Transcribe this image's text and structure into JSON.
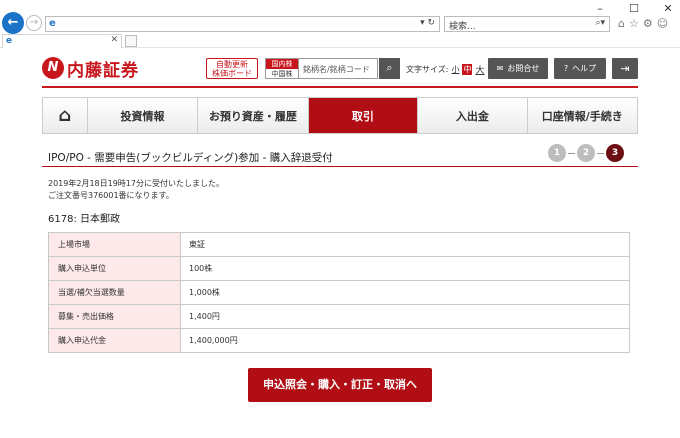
{
  "browser": {
    "window_controls": [
      "–",
      "☐",
      "✕"
    ],
    "search_placeholder": "検索...",
    "addr_tools": "▾  ↻"
  },
  "header": {
    "logo_text": "内藤証券",
    "auto_board_line1": "自動更新",
    "auto_board_line2": "株価ボード",
    "market_top": "国内株",
    "market_bottom": "中国株",
    "stock_search_placeholder": "銘柄名/銘柄コード",
    "font_size_label": "文字サイズ:",
    "font_small": "小",
    "font_medium": "中",
    "font_large": "大",
    "contact_label": "お問合せ",
    "help_label": "ヘルプ"
  },
  "nav": {
    "items": [
      {
        "label": "投資情報"
      },
      {
        "label": "お預り資産・履歴"
      },
      {
        "label": "取引"
      },
      {
        "label": "入出金"
      },
      {
        "label": "口座情報/手続き"
      }
    ],
    "active_index": 2
  },
  "page": {
    "title": "IPO/PO - 需要申告(ブックビルディング)参加 - 購入辞退受付",
    "steps": [
      "1",
      "2",
      "3"
    ],
    "current_step": 3,
    "message_line1": "2019年2月18日19時17分に受付いたしました。",
    "message_line2": "ご注文番号376001番になります。",
    "stock": "6178: 日本郵政"
  },
  "table": {
    "rows": [
      {
        "label": "上場市場",
        "value": "東証"
      },
      {
        "label": "購入申込単位",
        "value": "100株"
      },
      {
        "label": "当選/補欠当選数量",
        "value": "1,000株"
      },
      {
        "label": "募集・売出価格",
        "value": "1,400円"
      },
      {
        "label": "購入申込代金",
        "value": "1,400,000円"
      }
    ]
  },
  "actions": {
    "submit_label": "申込照会・購入・訂正・取消へ"
  },
  "colors": {
    "brand_red": "#c8161d",
    "active_nav": "#b00d14",
    "table_border": "#7a1c20",
    "label_bg": "#fde8ea"
  }
}
